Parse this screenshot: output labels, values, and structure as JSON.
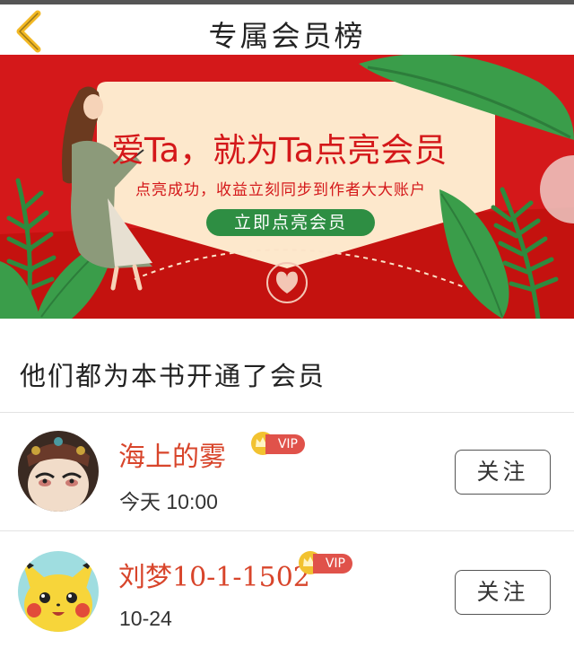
{
  "header": {
    "title": "专属会员榜",
    "back_icon": "chevron-left-icon"
  },
  "banner": {
    "headline": "爱Ta，就为Ta点亮会员",
    "subtitle": "点亮成功，收益立刻同步到作者大大账户",
    "cta_label": "立即点亮会员",
    "colors": {
      "background": "#d4181a",
      "card": "#fde8cc",
      "cta": "#2e8e43",
      "leaf": "#3a9d4a"
    }
  },
  "members_section": {
    "title": "他们都为本书开通了会员"
  },
  "members": [
    {
      "name": "海上的雾",
      "badge": "VIP",
      "time": "今天 10:00",
      "follow_label": "关注",
      "avatar": "opera-mask-avatar"
    },
    {
      "name": "刘梦10-1-1502",
      "badge": "VIP",
      "time": "10-24",
      "follow_label": "关注",
      "avatar": "pikachu-avatar"
    }
  ],
  "colors": {
    "name": "#d8452b",
    "vip": "#e0524a",
    "crown": "#f2c230"
  }
}
